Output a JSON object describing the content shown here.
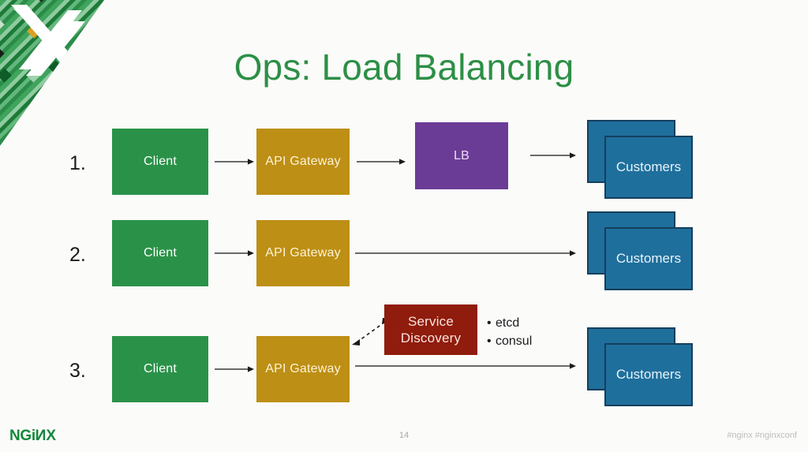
{
  "slide": {
    "title": "Ops: Load Balancing",
    "title_color": "#2d8f46",
    "background": "#fbfbfa"
  },
  "colors": {
    "client": "#2a9248",
    "gateway": "#bd8f14",
    "lb": "#6b3c96",
    "customers": "#1f6f9c",
    "customers_border": "#143f5c",
    "service_discovery": "#8f1c0c",
    "title_green": "#2d8f46",
    "logo_green": "#16873c"
  },
  "rows": [
    {
      "number": "1.",
      "client": "Client",
      "gateway": "API Gateway",
      "lb": "LB",
      "customers": "Customers"
    },
    {
      "number": "2.",
      "client": "Client",
      "gateway": "API Gateway",
      "customers": "Customers"
    },
    {
      "number": "3.",
      "client": "Client",
      "gateway": "API Gateway",
      "service_discovery": "Service Discovery",
      "customers": "Customers",
      "bullets": [
        "etcd",
        "consul"
      ]
    }
  ],
  "footer": {
    "logo": "NGiNX",
    "logo_part1": "NGi",
    "logo_part2": "N",
    "logo_part3": "X",
    "page": "14",
    "tags": "#nginx  #nginxconf"
  }
}
